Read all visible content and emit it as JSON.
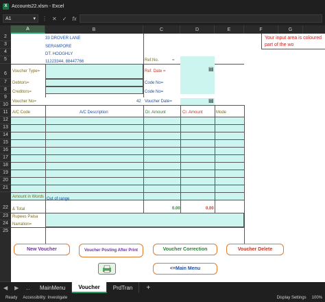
{
  "titlebar": {
    "app_letter": "X",
    "title": "Accounts22.xlsm - Excel"
  },
  "formula_bar": {
    "cell_ref": "A1",
    "cancel": "✕",
    "enter": "✓",
    "fx": "fx"
  },
  "columns": [
    "A",
    "B",
    "C",
    "D",
    "E",
    "F",
    "G"
  ],
  "rows": [
    "2",
    "3",
    "4",
    "5",
    "6",
    "7",
    "8",
    "9",
    "10",
    "11",
    "12",
    "13",
    "14",
    "15",
    "16",
    "17",
    "18",
    "19",
    "20",
    "21",
    "22",
    "23",
    "24",
    "25"
  ],
  "address": {
    "line1": "33 DROVER LANE",
    "line2": "SERAMPORE",
    "line3": "DT. HOOGHLY",
    "phone": "11223344, 88447766"
  },
  "labels": {
    "voucher_type": "Voucher Type=",
    "debtors": "Debtors=",
    "creditors": "Creditors=",
    "voucher_no": "Voucher No=",
    "voucher_no_value": "42",
    "ref_no": "Ref.No.",
    "ref_no_eq": "=",
    "ref_date": "Ref. Date =",
    "code_no_1": "Code No=",
    "code_no_2": "Code No=",
    "voucher_date": "Voucher Date="
  },
  "table_headers": {
    "ac_code": "A/C Code",
    "ac_desc": "A/C Description",
    "dr_amount": "Dr. Amount",
    "cr_amount": "Cr. Amount",
    "mode": "Mode"
  },
  "footer": {
    "amount_words": "Amount in Words",
    "out_of_range": "Out of range",
    "and_total": "& Total",
    "dr_total": "0.00",
    "cr_total": "0.00",
    "rupees_paisa": "Rupees Paisa",
    "narration": "Narration="
  },
  "note": {
    "text": "Your input area is coloured part of the wo"
  },
  "buttons": {
    "new_voucher": "New Voucher",
    "posting_after_print": "Voucher Posting After Print",
    "voucher_correction": "Voucher Correction",
    "voucher_delete": "Voucher Delete",
    "main_menu": "<=Main Menu"
  },
  "sheet_tabs": {
    "prev": "◀",
    "next": "▶",
    "more": "...",
    "tabs": [
      "MainMenu",
      "Voucher",
      "PrdTran"
    ],
    "add": "+"
  },
  "statusbar": {
    "ready": "Ready",
    "accessibility": "Accessibility: Investigate",
    "display_settings": "Display Settings",
    "zoom": "100%"
  }
}
